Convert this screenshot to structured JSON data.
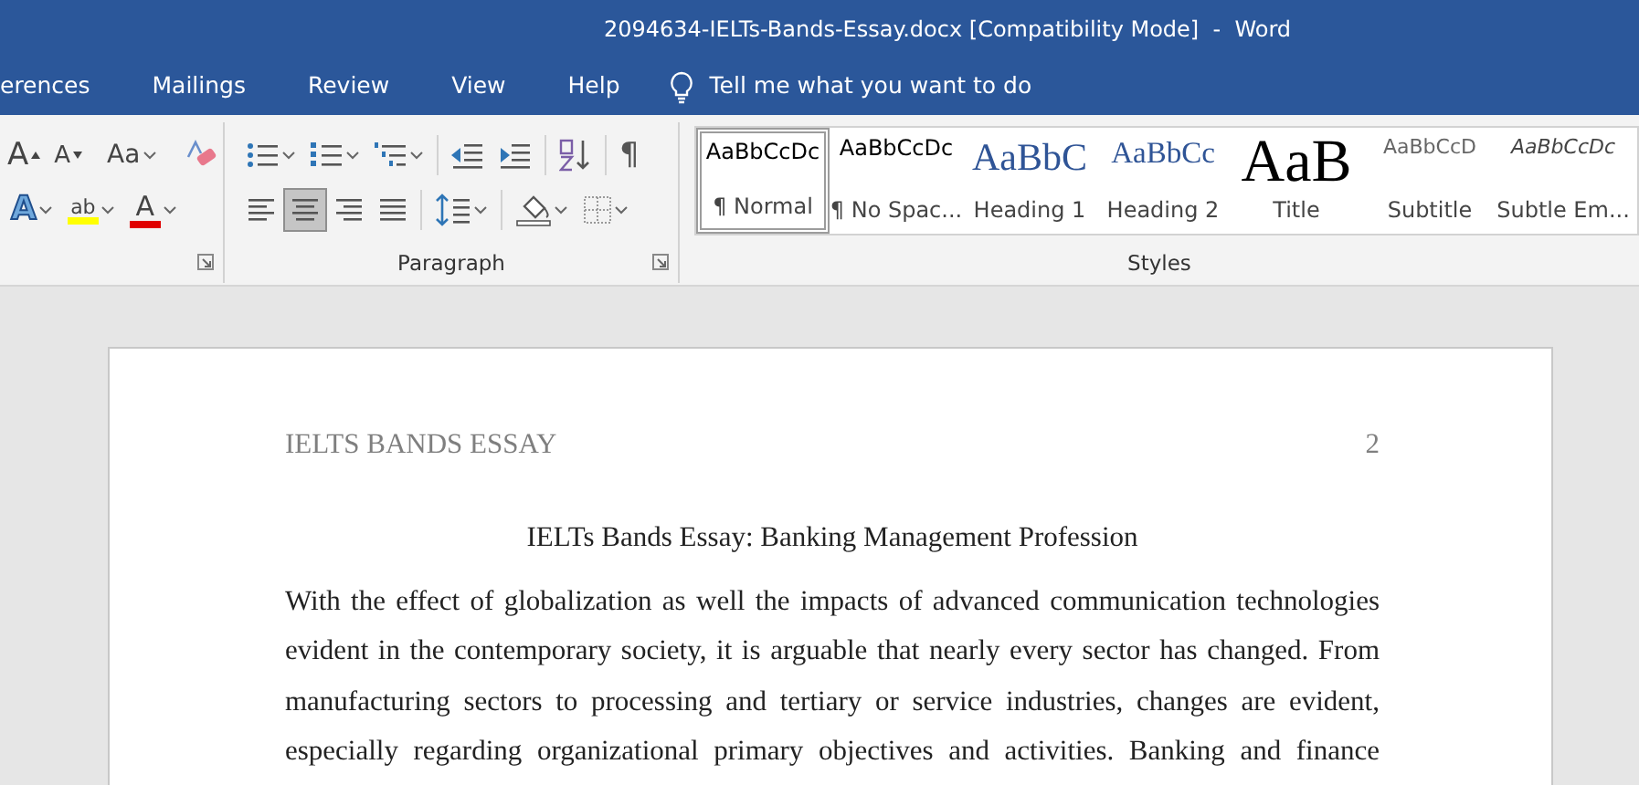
{
  "window": {
    "title": "2094634-IELTs-Bands-Essay.docx [Compatibility Mode]  -  Word"
  },
  "tabs": [
    {
      "label": "erences",
      "selected": false
    },
    {
      "label": "Mailings",
      "selected": false
    },
    {
      "label": "Review",
      "selected": false
    },
    {
      "label": "View",
      "selected": false
    },
    {
      "label": "Help",
      "selected": false
    }
  ],
  "tell_me": {
    "placeholder": "Tell me what you want to do"
  },
  "font_group": {
    "row1": [
      {
        "kind": "grow",
        "label": "A"
      },
      {
        "kind": "shrink",
        "label": "A"
      },
      {
        "kind": "case",
        "label": "Aa",
        "dropdown": true
      },
      {
        "kind": "clear"
      }
    ],
    "row2": [
      {
        "kind": "effects",
        "label": "A",
        "dropdown": true
      },
      {
        "kind": "highlight",
        "label": "ab",
        "dropdown": true,
        "color": "#ffff00"
      },
      {
        "kind": "fontcolor",
        "label": "A",
        "dropdown": true,
        "color": "#e00000"
      }
    ]
  },
  "paragraph_group": {
    "label": "Paragraph",
    "row1": [
      {
        "kind": "bullets",
        "dropdown": true
      },
      {
        "kind": "numbering",
        "dropdown": true
      },
      {
        "kind": "multilevel",
        "dropdown": true
      },
      {
        "kind": "outdent"
      },
      {
        "kind": "indent"
      },
      {
        "kind": "sort"
      },
      {
        "kind": "marks",
        "label": "¶"
      }
    ],
    "alignment": [
      {
        "kind": "left",
        "selected": false
      },
      {
        "kind": "center",
        "selected": true
      },
      {
        "kind": "right",
        "selected": false
      },
      {
        "kind": "justify",
        "selected": false
      }
    ],
    "row2": [
      {
        "kind": "spacing",
        "dropdown": true
      },
      {
        "kind": "shading",
        "dropdown": true
      },
      {
        "kind": "borders",
        "dropdown": true
      }
    ]
  },
  "styles_group": {
    "label": "Styles",
    "items": [
      {
        "kind": "normal",
        "preview": "AaBbCcDc",
        "name": "¶ Normal",
        "selected": true
      },
      {
        "kind": "nospacing",
        "preview": "AaBbCcDc",
        "name": "¶ No Spac...",
        "selected": false
      },
      {
        "kind": "heading1",
        "preview": "AaBbC",
        "name": "Heading 1",
        "selected": false
      },
      {
        "kind": "heading2",
        "preview": "AaBbCc",
        "name": "Heading 2",
        "selected": false
      },
      {
        "kind": "title",
        "preview": "AaB",
        "name": "Title",
        "selected": false
      },
      {
        "kind": "subtitle",
        "preview": "AaBbCcD",
        "name": "Subtitle",
        "selected": false
      },
      {
        "kind": "subtleem",
        "preview": "AaBbCcDc",
        "name": "Subtle Em...",
        "selected": false
      }
    ]
  },
  "document": {
    "header": "IELTS BANDS ESSAY",
    "page_number": "2",
    "title": "IELTs Bands Essay: Banking Management Profession",
    "paragraph": "With the effect of globalization as well the impacts of advanced communication technologies evident in the contemporary society, it is arguable that nearly every sector has changed. From manufacturing sectors to processing and tertiary or service industries, changes are evident, especially regarding organizational primary objectives and activities. Banking and finance"
  }
}
